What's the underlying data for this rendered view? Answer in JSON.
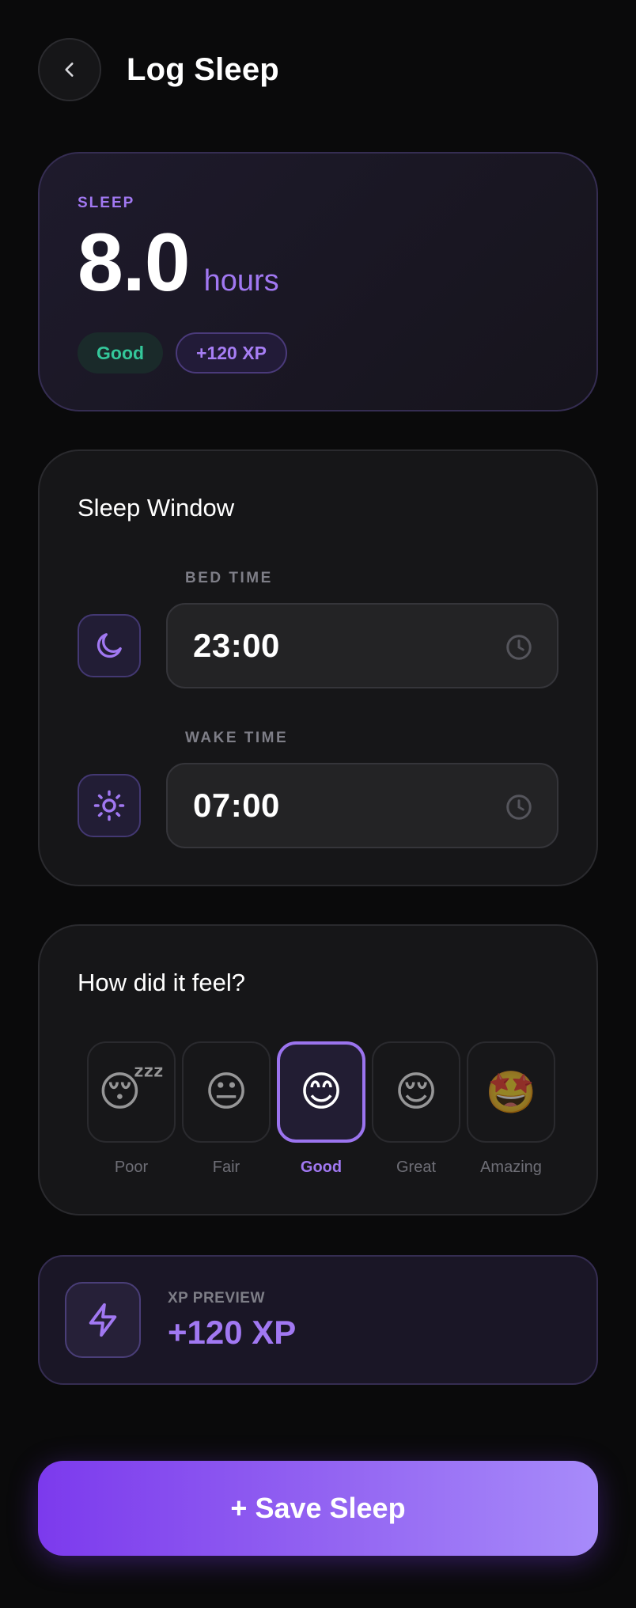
{
  "header": {
    "title": "Log Sleep",
    "back_icon": "chevron-left-icon"
  },
  "sleep_summary": {
    "eyebrow": "SLEEP",
    "value": "8.0",
    "unit": "hours",
    "quality_badge": "Good",
    "xp_badge": "+120 XP"
  },
  "sleep_window": {
    "title": "Sleep Window",
    "bed": {
      "label": "BED TIME",
      "value": "23:00",
      "icon": "moon-icon"
    },
    "wake": {
      "label": "WAKE TIME",
      "value": "07:00",
      "icon": "sun-icon"
    }
  },
  "feel": {
    "title": "How did it feel?",
    "selected": "Good",
    "options": [
      {
        "label": "Poor",
        "emoji": "😴"
      },
      {
        "label": "Fair",
        "emoji": "😐"
      },
      {
        "label": "Good",
        "emoji": "😊"
      },
      {
        "label": "Great",
        "emoji": "😌"
      },
      {
        "label": "Amazing",
        "emoji": "🤩"
      }
    ]
  },
  "xp_preview": {
    "label": "XP PREVIEW",
    "value": "+120 XP",
    "icon": "lightning-icon"
  },
  "save_button": {
    "label": "+ Save Sleep"
  },
  "colors": {
    "accent": "#a178f2",
    "good": "#34c79a",
    "background": "#0a0a0b"
  }
}
